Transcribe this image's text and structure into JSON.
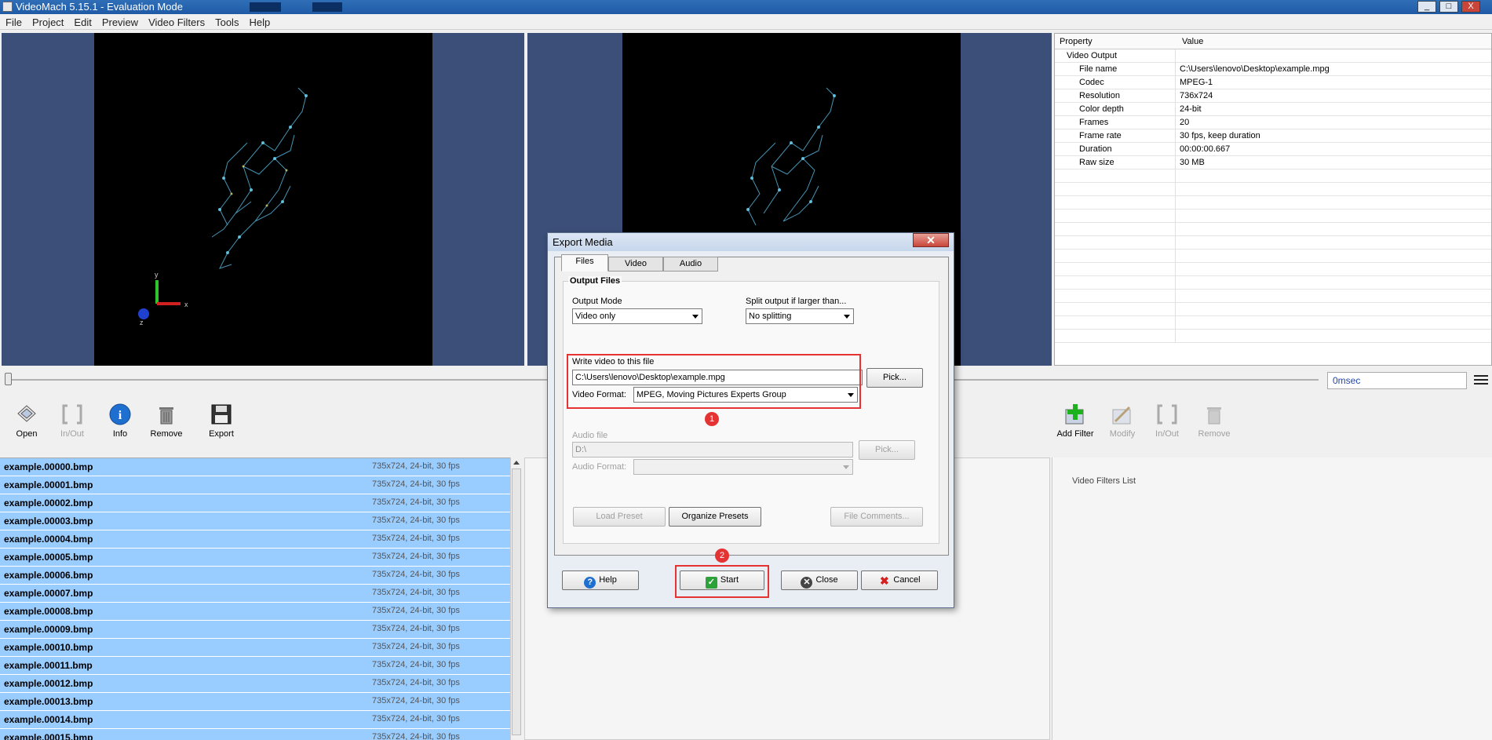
{
  "window": {
    "title": "VideoMach 5.15.1 - Evaluation Mode",
    "controls": [
      "_",
      "□",
      "X"
    ]
  },
  "menu": [
    "File",
    "Project",
    "Edit",
    "Preview",
    "Video Filters",
    "Tools",
    "Help"
  ],
  "properties": {
    "headers": [
      "Property",
      "Value"
    ],
    "group": "Video Output",
    "rows": [
      {
        "key": "File name",
        "value": "C:\\Users\\lenovo\\Desktop\\example.mpg"
      },
      {
        "key": "Codec",
        "value": "MPEG-1"
      },
      {
        "key": "Resolution",
        "value": "736x724"
      },
      {
        "key": "Color depth",
        "value": "24-bit"
      },
      {
        "key": "Frames",
        "value": "20"
      },
      {
        "key": "Frame rate",
        "value": "30 fps, keep duration"
      },
      {
        "key": "Duration",
        "value": "00:00:00.667"
      },
      {
        "key": "Raw size",
        "value": "30 MB"
      }
    ]
  },
  "timeline": {
    "time": "0msec"
  },
  "toolbar_left": [
    {
      "label": "Open",
      "icon": "open-icon",
      "enabled": true
    },
    {
      "label": "In/Out",
      "icon": "in-out-icon",
      "enabled": false
    },
    {
      "label": "Info",
      "icon": "info-icon",
      "enabled": true
    },
    {
      "label": "Remove",
      "icon": "trash-icon",
      "enabled": true
    },
    {
      "label": "Export",
      "icon": "floppy-disk-icon",
      "enabled": true
    }
  ],
  "toolbar_right": [
    {
      "label": "Add Filter",
      "icon": "add-filter-icon",
      "enabled": true
    },
    {
      "label": "Modify",
      "icon": "modify-icon",
      "enabled": false
    },
    {
      "label": "In/Out",
      "icon": "in-out-icon",
      "enabled": false
    },
    {
      "label": "Remove",
      "icon": "trash-icon",
      "enabled": false
    }
  ],
  "files": [
    {
      "name": "example.00000.bmp",
      "info": "735x724, 24-bit, 30 fps"
    },
    {
      "name": "example.00001.bmp",
      "info": "735x724, 24-bit, 30 fps"
    },
    {
      "name": "example.00002.bmp",
      "info": "735x724, 24-bit, 30 fps"
    },
    {
      "name": "example.00003.bmp",
      "info": "735x724, 24-bit, 30 fps"
    },
    {
      "name": "example.00004.bmp",
      "info": "735x724, 24-bit, 30 fps"
    },
    {
      "name": "example.00005.bmp",
      "info": "735x724, 24-bit, 30 fps"
    },
    {
      "name": "example.00006.bmp",
      "info": "735x724, 24-bit, 30 fps"
    },
    {
      "name": "example.00007.bmp",
      "info": "735x724, 24-bit, 30 fps"
    },
    {
      "name": "example.00008.bmp",
      "info": "735x724, 24-bit, 30 fps"
    },
    {
      "name": "example.00009.bmp",
      "info": "735x724, 24-bit, 30 fps"
    },
    {
      "name": "example.00010.bmp",
      "info": "735x724, 24-bit, 30 fps"
    },
    {
      "name": "example.00011.bmp",
      "info": "735x724, 24-bit, 30 fps"
    },
    {
      "name": "example.00012.bmp",
      "info": "735x724, 24-bit, 30 fps"
    },
    {
      "name": "example.00013.bmp",
      "info": "735x724, 24-bit, 30 fps"
    },
    {
      "name": "example.00014.bmp",
      "info": "735x724, 24-bit, 30 fps"
    },
    {
      "name": "example.00015.bmp",
      "info": "735x724, 24-bit, 30 fps"
    }
  ],
  "filters": {
    "list_label": "Video Filters List"
  },
  "dialog": {
    "title": "Export Media",
    "tabs": [
      "Files",
      "Video",
      "Audio"
    ],
    "group_title": "Output Files",
    "output_mode_label": "Output Mode",
    "output_mode_value": "Video only",
    "split_label": "Split output if larger than...",
    "split_value": "No splitting",
    "write_label": "Write video to this file",
    "write_value": "C:\\Users\\lenovo\\Desktop\\example.mpg",
    "pick_label": "Pick...",
    "format_label": "Video Format:",
    "format_value": "MPEG, Moving Pictures Experts Group",
    "audio_file_label": "Audio file",
    "audio_file_value": "D:\\",
    "audio_pick_label": "Pick...",
    "audio_format_label": "Audio Format:",
    "load_preset_label": "Load Preset",
    "organize_presets_label": "Organize Presets",
    "file_comments_label": "File Comments...",
    "help_label": "Help",
    "start_label": "Start",
    "close_label": "Close",
    "cancel_label": "Cancel",
    "badge_1": "1",
    "badge_2": "2"
  },
  "axes": {
    "x": "x",
    "y": "y",
    "z": "z"
  },
  "colors": {
    "title_bar": "#1f5aa5",
    "preview_bg": "#3b4f79",
    "selection": "#99ccff",
    "highlight": "#e53333"
  }
}
